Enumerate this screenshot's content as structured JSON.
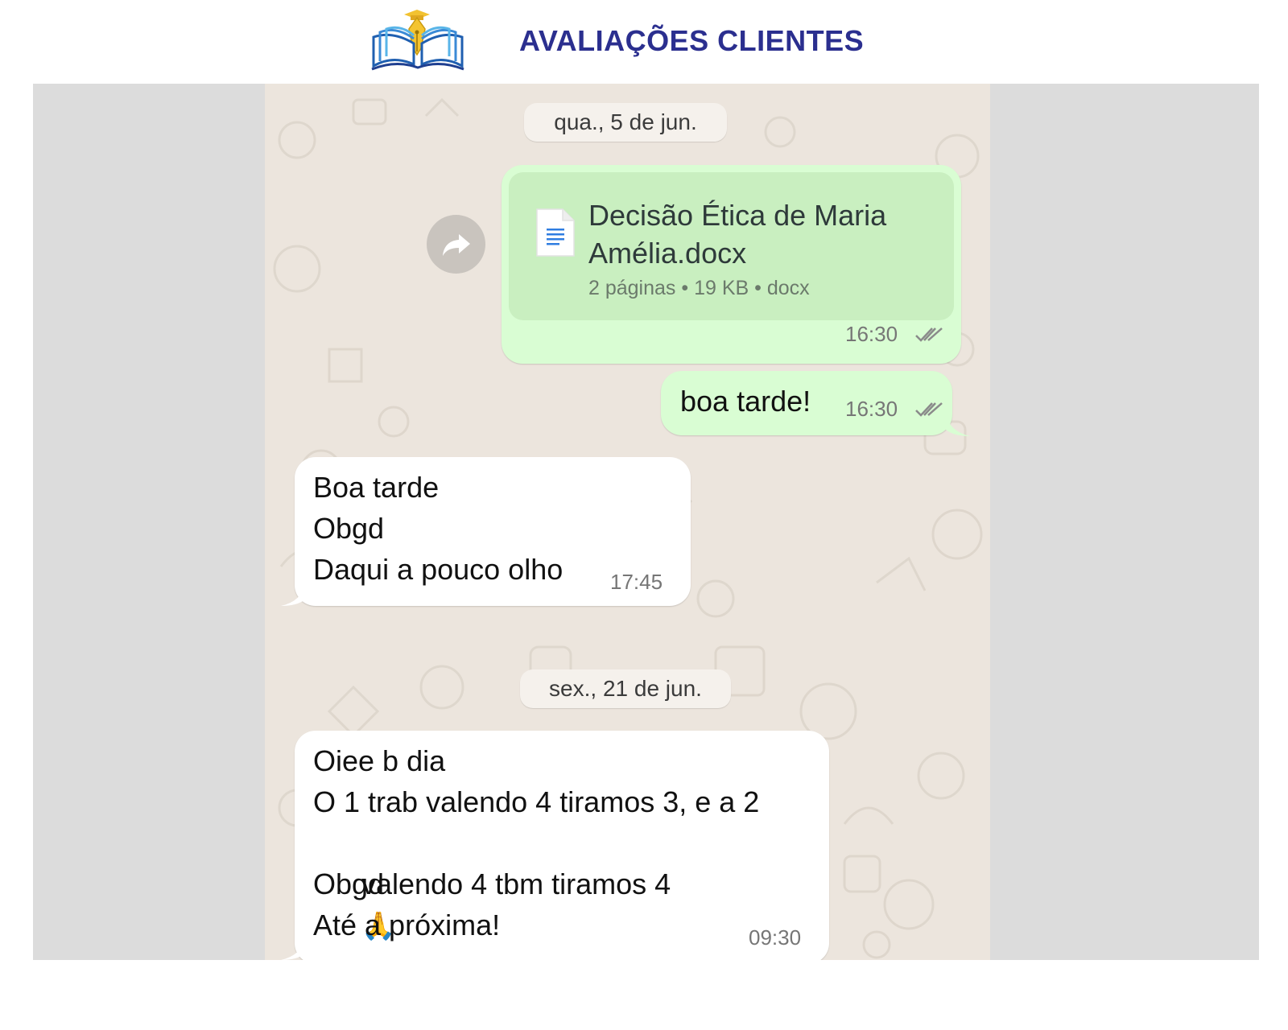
{
  "header": {
    "title": "AVALIAÇÕES CLIENTES"
  },
  "colors": {
    "title": "#2b2f8f",
    "outgoing_bubble": "#d9fdd3",
    "incoming_bubble": "#ffffff",
    "chat_background": "#ece5dd",
    "side_band": "#dcdcdc"
  },
  "chat": {
    "date_1": "qua., 5 de jun.",
    "document": {
      "name_line1": "Decisão Ética de Maria",
      "name_line2": "Amélia.docx",
      "meta": "2 páginas • 19 KB • docx",
      "time": "16:30",
      "icon": "document-icon"
    },
    "forward_icon": "forward-icon",
    "msg_out_1": {
      "text": "boa tarde!",
      "time": "16:30"
    },
    "msg_in_1": {
      "line1": "Boa tarde",
      "line2": "Obgd",
      "line3": "Daqui a pouco olho",
      "time": "17:45"
    },
    "date_2": "sex., 21 de jun.",
    "msg_in_2": {
      "line1": "Oiee b dia",
      "line2": "O 1 trab valendo 4 tiramos 3, e a 2",
      "line3": "valendo 4 tbm tiramos 4",
      "emoji": "🙏",
      "line4": "Obgd",
      "line5": "Até a próxima!",
      "time": "09:30"
    }
  }
}
